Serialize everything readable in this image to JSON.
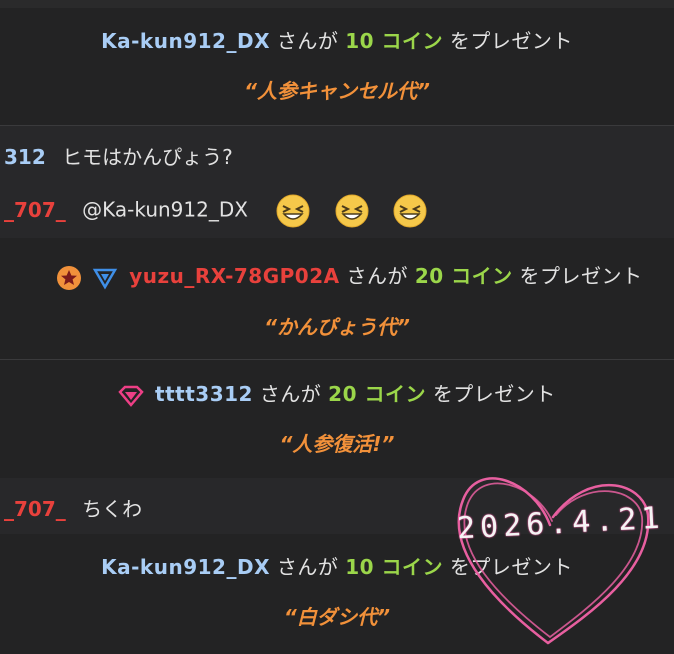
{
  "gifts": [
    {
      "user": "Ka-kun912_DX",
      "particle": "さんが",
      "coins": "10 コイン",
      "action": "をプレゼント",
      "message": "“人参キャンセル代”"
    },
    {
      "user": "yuzu_RX-78GP02A",
      "particle": "さんが",
      "coins": "20 コイン",
      "action": "をプレゼント",
      "message": "“かんぴょう代”"
    },
    {
      "user": "tttt3312",
      "particle": "さんが",
      "coins": "20 コイン",
      "action": "をプレゼント",
      "message": "“人参復活!”"
    },
    {
      "user": "Ka-kun912_DX",
      "particle": "さんが",
      "coins": "10 コイン",
      "action": "をプレゼント",
      "message": "“白ダシ代”"
    }
  ],
  "chats": [
    {
      "name": "312",
      "text": "ヒモはかんぴょう?"
    },
    {
      "name": "_707_",
      "text": "@Ka-kun912_DX"
    },
    {
      "name": "_707_",
      "text": "ちくわ"
    }
  ],
  "handwritten_date": "2026.4.21",
  "colors": {
    "background": "#1e1e1f",
    "username_blue": "#a9cdf5",
    "username_red": "#e8413c",
    "coin_green": "#9bd64a",
    "message_orange": "#f2913a",
    "heart_pink": "#e85fa0"
  },
  "icons": [
    "star-badge-icon",
    "triangle-badge-icon",
    "gem-badge-icon",
    "grinning-emoji-icon"
  ]
}
